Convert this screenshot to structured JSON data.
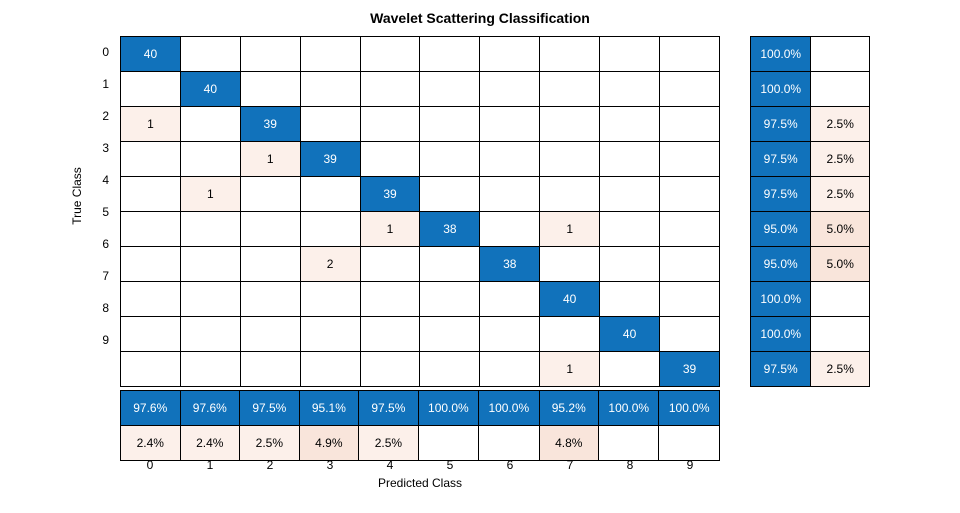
{
  "chart_data": {
    "type": "heatmap",
    "title": "Wavelet Scattering Classification",
    "xlabel": "Predicted Class",
    "ylabel": "True Class",
    "classes": [
      "0",
      "1",
      "2",
      "3",
      "4",
      "5",
      "6",
      "7",
      "8",
      "9"
    ],
    "confusion_matrix": [
      [
        40,
        0,
        0,
        0,
        0,
        0,
        0,
        0,
        0,
        0
      ],
      [
        0,
        40,
        0,
        0,
        0,
        0,
        0,
        0,
        0,
        0
      ],
      [
        1,
        0,
        39,
        0,
        0,
        0,
        0,
        0,
        0,
        0
      ],
      [
        0,
        0,
        1,
        39,
        0,
        0,
        0,
        0,
        0,
        0
      ],
      [
        0,
        1,
        0,
        0,
        39,
        0,
        0,
        0,
        0,
        0
      ],
      [
        0,
        0,
        0,
        0,
        1,
        38,
        0,
        1,
        0,
        0
      ],
      [
        0,
        0,
        0,
        2,
        0,
        0,
        38,
        0,
        0,
        0
      ],
      [
        0,
        0,
        0,
        0,
        0,
        0,
        0,
        40,
        0,
        0
      ],
      [
        0,
        0,
        0,
        0,
        0,
        0,
        0,
        0,
        40,
        0
      ],
      [
        0,
        0,
        0,
        0,
        0,
        0,
        0,
        1,
        0,
        39
      ]
    ],
    "row_summary": [
      {
        "correct_pct": "100.0%",
        "wrong_pct": ""
      },
      {
        "correct_pct": "100.0%",
        "wrong_pct": ""
      },
      {
        "correct_pct": "97.5%",
        "wrong_pct": "2.5%"
      },
      {
        "correct_pct": "97.5%",
        "wrong_pct": "2.5%"
      },
      {
        "correct_pct": "97.5%",
        "wrong_pct": "2.5%"
      },
      {
        "correct_pct": "95.0%",
        "wrong_pct": "5.0%"
      },
      {
        "correct_pct": "95.0%",
        "wrong_pct": "5.0%"
      },
      {
        "correct_pct": "100.0%",
        "wrong_pct": ""
      },
      {
        "correct_pct": "100.0%",
        "wrong_pct": ""
      },
      {
        "correct_pct": "97.5%",
        "wrong_pct": "2.5%"
      }
    ],
    "col_summary": [
      {
        "correct_pct": "97.6%",
        "wrong_pct": "2.4%"
      },
      {
        "correct_pct": "97.6%",
        "wrong_pct": "2.4%"
      },
      {
        "correct_pct": "97.5%",
        "wrong_pct": "2.5%"
      },
      {
        "correct_pct": "95.1%",
        "wrong_pct": "4.9%"
      },
      {
        "correct_pct": "97.5%",
        "wrong_pct": "2.5%"
      },
      {
        "correct_pct": "100.0%",
        "wrong_pct": ""
      },
      {
        "correct_pct": "100.0%",
        "wrong_pct": ""
      },
      {
        "correct_pct": "95.2%",
        "wrong_pct": "4.8%"
      },
      {
        "correct_pct": "100.0%",
        "wrong_pct": ""
      },
      {
        "correct_pct": "100.0%",
        "wrong_pct": ""
      }
    ]
  }
}
